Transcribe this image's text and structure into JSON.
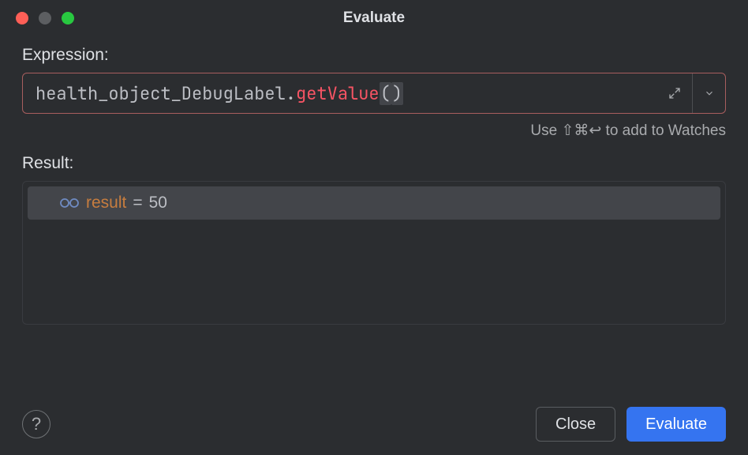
{
  "window": {
    "title": "Evaluate"
  },
  "expression": {
    "label": "Expression:",
    "tokens": {
      "identifier": "health_object_DebugLabel",
      "dot": ".",
      "method": "getValue",
      "open_paren": "(",
      "close_paren": ")"
    }
  },
  "hint": "Use ⇧⌘↩ to add to Watches",
  "result": {
    "label": "Result:",
    "items": [
      {
        "name": "result",
        "equals": " = ",
        "value": "50"
      }
    ]
  },
  "buttons": {
    "help": "?",
    "close": "Close",
    "evaluate": "Evaluate"
  }
}
